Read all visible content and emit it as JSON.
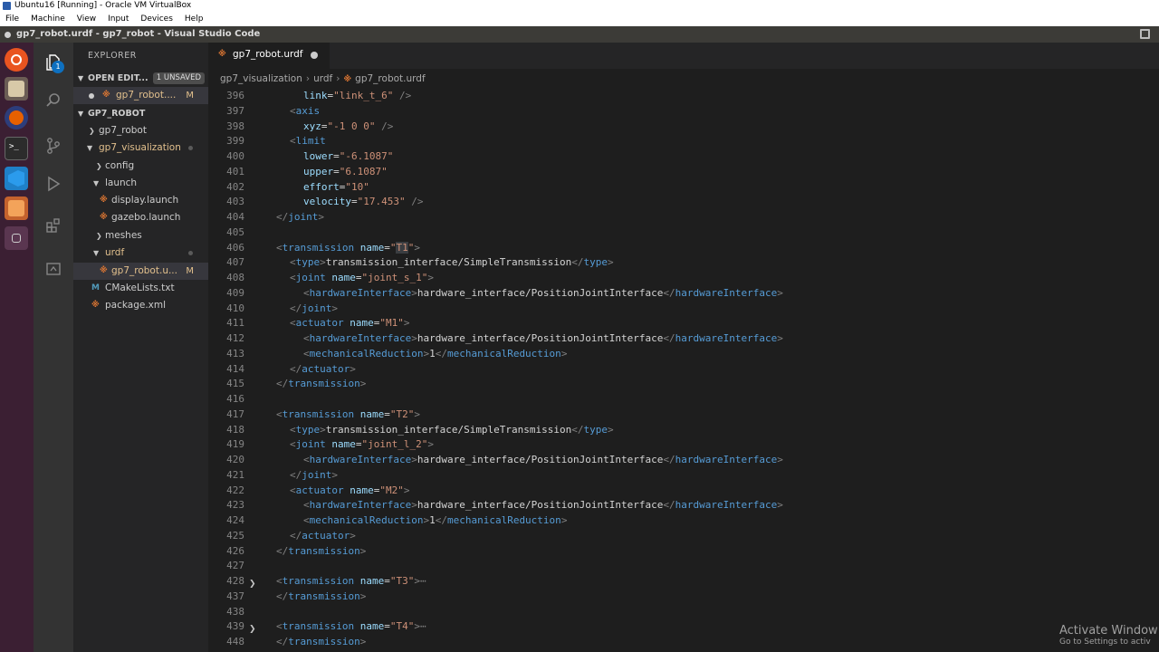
{
  "vbox": {
    "title": "Ubuntu16 [Running] - Oracle VM VirtualBox",
    "menu": [
      "File",
      "Machine",
      "View",
      "Input",
      "Devices",
      "Help"
    ]
  },
  "window": {
    "title": "gp7_robot.urdf - gp7_robot - Visual Studio Code"
  },
  "activity_bar": {
    "explorer_badge": "1"
  },
  "sidebar": {
    "header": "EXPLORER",
    "open_editors": {
      "label": "OPEN EDIT...",
      "unsaved": "1 UNSAVED",
      "file": "gp7_robot....",
      "file_status": "M"
    },
    "project": {
      "label": "GP7_ROBOT",
      "items": [
        {
          "label": "gp7_robot"
        },
        {
          "label": "gp7_visualization"
        },
        {
          "label": "config"
        },
        {
          "label": "launch"
        },
        {
          "label": "display.launch"
        },
        {
          "label": "gazebo.launch"
        },
        {
          "label": "meshes"
        },
        {
          "label": "urdf"
        },
        {
          "label": "gp7_robot.u...",
          "status": "M"
        },
        {
          "label": "CMakeLists.txt"
        },
        {
          "label": "package.xml"
        }
      ]
    }
  },
  "tab": {
    "label": "gp7_robot.urdf"
  },
  "breadcrumb": [
    "gp7_visualization",
    "urdf",
    "gp7_robot.urdf"
  ],
  "line_numbers": [
    "396",
    "397",
    "398",
    "399",
    "400",
    "401",
    "402",
    "403",
    "404",
    "405",
    "406",
    "407",
    "408",
    "409",
    "410",
    "411",
    "412",
    "413",
    "414",
    "415",
    "416",
    "417",
    "418",
    "419",
    "420",
    "421",
    "422",
    "423",
    "424",
    "425",
    "426",
    "427",
    "428",
    "437",
    "438",
    "439",
    "448"
  ],
  "code": {
    "l396": {
      "a": "link",
      "v": "\"link_t_6\""
    },
    "l398": {
      "a": "xyz",
      "v": "\"-1 0 0\""
    },
    "l400": {
      "a": "lower",
      "v": "\"-6.1087\""
    },
    "l401": {
      "a": "upper",
      "v": "\"6.1087\""
    },
    "l402": {
      "a": "effort",
      "v": "\"10\""
    },
    "l403": {
      "a": "velocity",
      "v": "\"17.453\""
    },
    "tag_axis": "axis",
    "tag_limit": "limit",
    "tag_joint": "joint",
    "tag_transmission": "transmission",
    "tag_type": "type",
    "tag_actuator": "actuator",
    "tag_hw": "hardwareInterface",
    "tag_mech": "mechanicalReduction",
    "attr_name": "name",
    "type_text": "transmission_interface/SimpleTransmission",
    "hw_text": "hardware_interface/PositionJointInterface",
    "mech_text": "1",
    "t1_name_open": "\"",
    "t1_name_val": "T1",
    "t1_name_close": "\"",
    "joint1_name": "\"joint_s_1\"",
    "m1_name": "\"M1\"",
    "t2_name": "\"T2\"",
    "joint2_name": "\"joint_l_2\"",
    "m2_name": "\"M2\"",
    "t3_name": "\"T3\"",
    "t4_name": "\"T4\"",
    "ellipsis": "⋯"
  },
  "watermark": {
    "line1": "Activate Window",
    "line2": "Go to Settings to activ"
  }
}
